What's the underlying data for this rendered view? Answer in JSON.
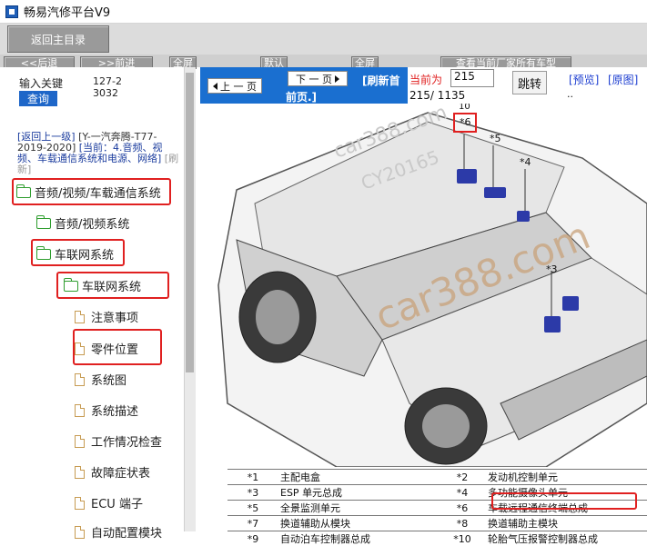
{
  "window": {
    "title": "畅易汽修平台V9"
  },
  "toolbar": {
    "return_label": "返回主目录",
    "nav_labels": [
      "<<后退",
      ">>前进",
      "全屏",
      "默认",
      "全屏",
      "查看当前厂家所有车型"
    ]
  },
  "search": {
    "label": "输入关键",
    "id_text": "127-23032",
    "query_label": "查询"
  },
  "breadcrumb": {
    "back_label": "[返回上一级]",
    "path_text": "[Y-一汽奔腾-T77-2019-2020]",
    "current_text": "[当前：4.音频、视频、车载通信系统和电源、网络]",
    "refresh_label": "[刷新]"
  },
  "tree": [
    {
      "label": "音频/视频/车载通信系统",
      "type": "folder"
    },
    {
      "label": "音频/视频系统",
      "type": "folder"
    },
    {
      "label": "车联网系统",
      "type": "folder"
    },
    {
      "label": "车联网系统",
      "type": "folder"
    },
    {
      "label": "注意事项",
      "type": "doc"
    },
    {
      "label": "零件位置",
      "type": "doc"
    },
    {
      "label": "系统图",
      "type": "doc"
    },
    {
      "label": "系统描述",
      "type": "doc"
    },
    {
      "label": "工作情况检查",
      "type": "doc"
    },
    {
      "label": "故障症状表",
      "type": "doc"
    },
    {
      "label": "ECU 端子",
      "type": "doc"
    },
    {
      "label": "自动配置模块",
      "type": "doc"
    }
  ],
  "viewer": {
    "prev_label": "上 一 页",
    "next_label": "下 一 页",
    "refresh_label": "[刷新首",
    "front_label": "前页.]",
    "current_label": "当前为",
    "page_value": "215",
    "page_count": "215/ 1135",
    "jump_label": "跳转",
    "preview_label": "[预览]",
    "original_label": "[原图]",
    "dots": ".."
  },
  "drawing": {
    "callouts": [
      "10",
      "*6",
      "*5",
      "*4",
      "*3"
    ],
    "watermarks": [
      "car388.com",
      "CY20165",
      "car388.com"
    ]
  },
  "parts_table": [
    [
      "*1",
      "主配电盒",
      "*2",
      "发动机控制单元"
    ],
    [
      "*3",
      "ESP 单元总成",
      "*4",
      "多功能摄像头单元"
    ],
    [
      "*5",
      "全景监测单元",
      "*6",
      "车载远程通信终端总成"
    ],
    [
      "*7",
      "换道辅助从模块",
      "*8",
      "换道辅助主模块"
    ],
    [
      "*9",
      "自动泊车控制器总成",
      "*10",
      "轮胎气压报警控制器总成"
    ]
  ],
  "colors": {
    "accent_blue": "#1a6fd0",
    "highlight_red": "#e02020",
    "folder_green": "#2e9d2e"
  }
}
